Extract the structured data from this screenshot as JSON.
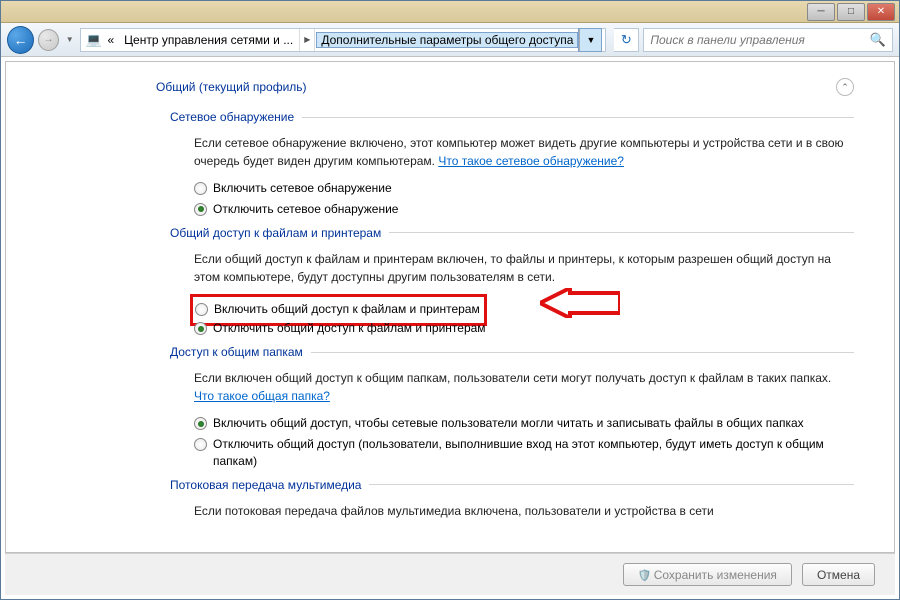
{
  "nav": {
    "breadcrumb_prefix": "«",
    "breadcrumb_seg1": "Центр управления сетями и ...",
    "breadcrumb_seg2": "Дополнительные параметры общего доступа",
    "search_placeholder": "Поиск в панели управления"
  },
  "profile": {
    "header": "Общий (текущий профиль)"
  },
  "s1": {
    "title": "Сетевое обнаружение",
    "desc_part1": "Если сетевое обнаружение включено, этот компьютер может видеть другие компьютеры и устройства сети и в свою очередь будет виден другим компьютерам. ",
    "link": "Что такое сетевое обнаружение?",
    "opt_on": "Включить сетевое обнаружение",
    "opt_off": "Отключить сетевое обнаружение"
  },
  "s2": {
    "title": "Общий доступ к файлам и принтерам",
    "desc": "Если общий доступ к файлам и принтерам включен, то файлы и принтеры, к которым разрешен общий доступ на этом компьютере, будут доступны другим пользователям в сети.",
    "opt_on": "Включить общий доступ к файлам и принтерам",
    "opt_off": "Отключить общий доступ к файлам и принтерам"
  },
  "s3": {
    "title": "Доступ к общим папкам",
    "desc_part1": "Если включен общий доступ к общим папкам, пользователи сети могут получать доступ к файлам в таких папках. ",
    "link": "Что такое общая папка?",
    "opt_on": "Включить общий доступ, чтобы сетевые пользователи могли читать и записывать файлы в общих папках",
    "opt_off": "Отключить общий доступ (пользователи, выполнившие вход на этот компьютер, будут иметь доступ к общим папкам)"
  },
  "s4": {
    "title": "Потоковая передача мультимедиа",
    "desc": "Если потоковая передача файлов мультимедиа включена, пользователи и устройства в сети"
  },
  "buttons": {
    "save": "Сохранить изменения",
    "cancel": "Отмена"
  }
}
